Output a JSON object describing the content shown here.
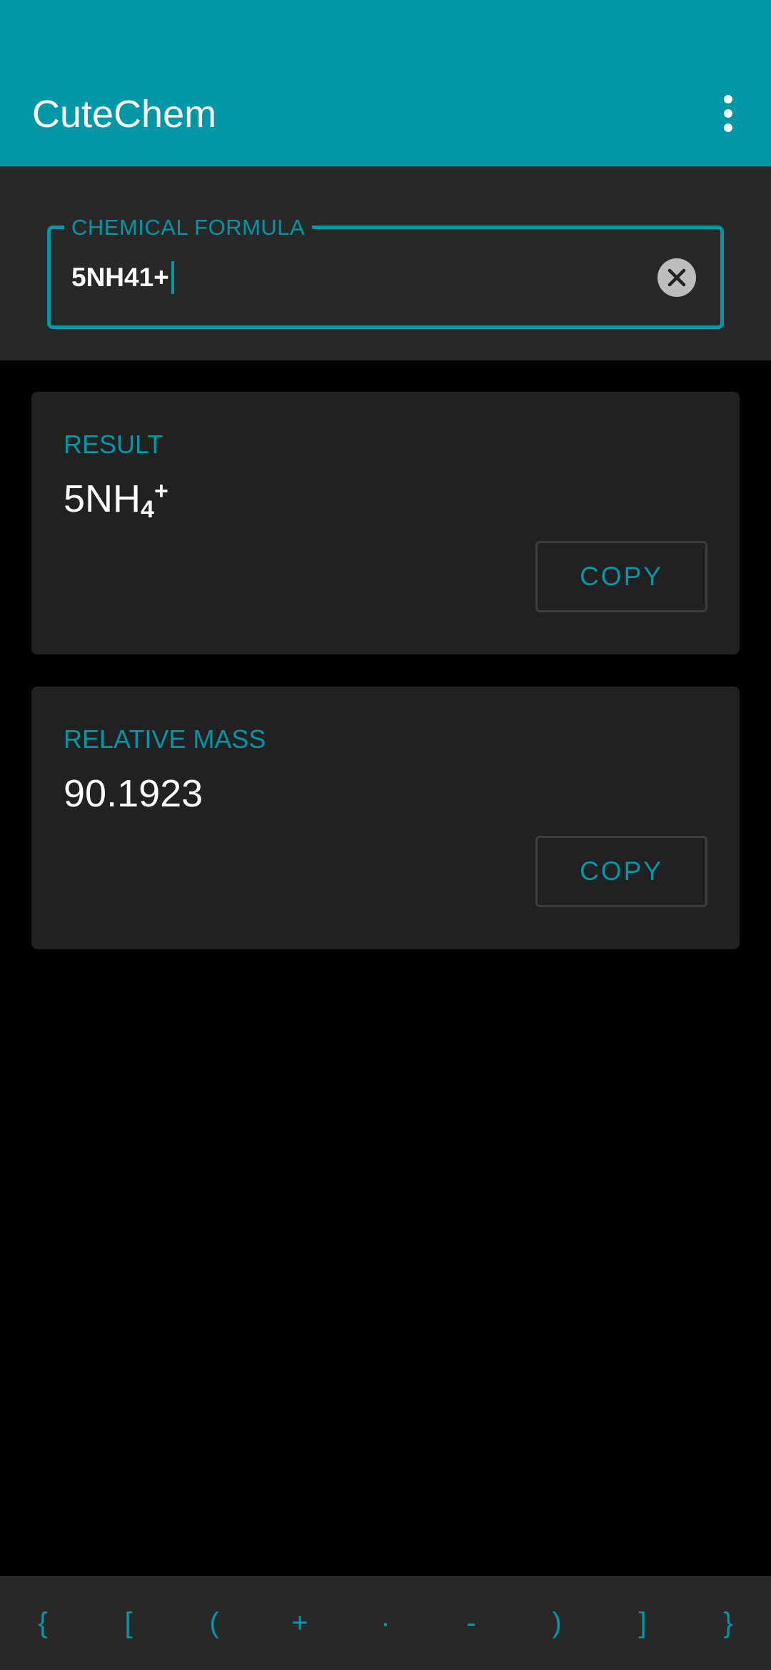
{
  "app_bar": {
    "title": "CuteChem",
    "menu_icon": "more-vert-icon"
  },
  "formula_input": {
    "label": "CHEMICAL FORMULA",
    "value": "5NH41+",
    "clear_icon": "clear-circle-icon"
  },
  "result_card": {
    "label": "RESULT",
    "value_base": "5NH",
    "value_subscript": "4",
    "value_superscript": "+",
    "copy_label": "COPY"
  },
  "mass_card": {
    "label": "RELATIVE MASS",
    "value": "90.1923",
    "copy_label": "COPY"
  },
  "symbol_keys": [
    "{",
    "[",
    "(",
    "+",
    "·",
    "-",
    ")",
    "]",
    "}"
  ],
  "colors": {
    "accent": "#0097a7",
    "panel": "#282828",
    "card": "#212121",
    "background": "#000000"
  }
}
